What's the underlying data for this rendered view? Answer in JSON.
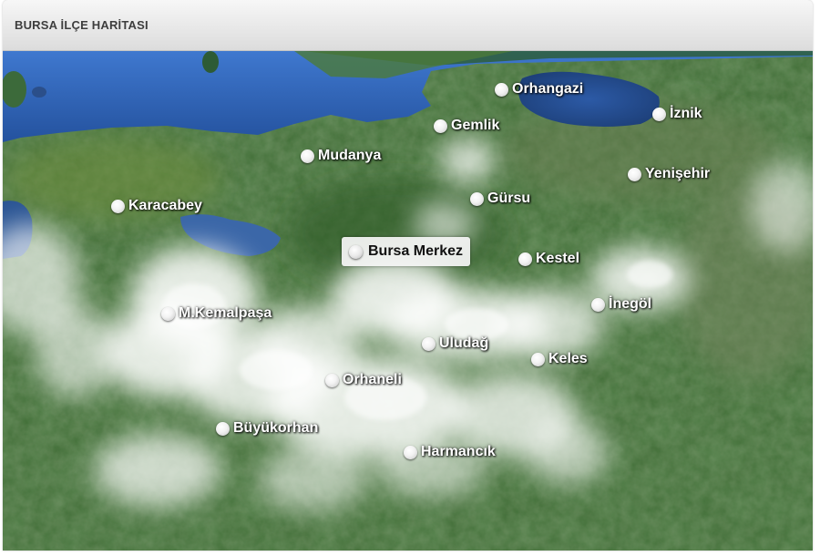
{
  "header": {
    "title": "BURSA İLÇE HARİTASI"
  },
  "map": {
    "selected": "Bursa Merkez",
    "districts": [
      {
        "name": "Orhangazi"
      },
      {
        "name": "İznik"
      },
      {
        "name": "Gemlik"
      },
      {
        "name": "Mudanya"
      },
      {
        "name": "Yenişehir"
      },
      {
        "name": "Gürsu"
      },
      {
        "name": "Karacabey"
      },
      {
        "name": "Bursa Merkez"
      },
      {
        "name": "Kestel"
      },
      {
        "name": "İnegöl"
      },
      {
        "name": "M.Kemalpaşa"
      },
      {
        "name": "Uludağ"
      },
      {
        "name": "Keles"
      },
      {
        "name": "Orhaneli"
      },
      {
        "name": "Büyükorhan"
      },
      {
        "name": "Harmancık"
      }
    ]
  },
  "colors": {
    "sea": "#2f64b8",
    "land": "#3a6e2f",
    "cloud": "#ffffff"
  }
}
